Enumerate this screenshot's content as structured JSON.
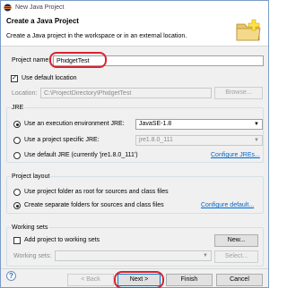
{
  "window": {
    "title": "New Java Project"
  },
  "banner": {
    "heading": "Create a Java Project",
    "description": "Create a Java project in the workspace or in an external location."
  },
  "project_name": {
    "label": "Project name:",
    "value": "PhidgetTest"
  },
  "location": {
    "use_default_label": "Use default location",
    "use_default_checked": true,
    "label": "Location:",
    "value": "C:\\ProjectDirectory\\PhidgetTest",
    "browse_label": "Browse..."
  },
  "jre": {
    "group_label": "JRE",
    "options": [
      {
        "label": "Use an execution environment JRE:",
        "selected": true,
        "value": "JavaSE-1.8"
      },
      {
        "label": "Use a project specific JRE:",
        "selected": false,
        "value": "jre1.8.0_111"
      },
      {
        "label": "Use default JRE (currently 'jre1.8.0_111')",
        "selected": false,
        "link": "Configure JREs..."
      }
    ]
  },
  "project_layout": {
    "group_label": "Project layout",
    "options": [
      {
        "label": "Use project folder as root for sources and class files",
        "selected": false
      },
      {
        "label": "Create separate folders for sources and class files",
        "selected": true,
        "link": "Configure default..."
      }
    ]
  },
  "working_sets": {
    "group_label": "Working sets",
    "add_label": "Add project to working sets",
    "add_checked": false,
    "new_label": "New...",
    "sets_label": "Working sets:",
    "select_label": "Select..."
  },
  "footer": {
    "help_glyph": "?",
    "back_label": "< Back",
    "next_label": "Next >",
    "finish_label": "Finish",
    "cancel_label": "Cancel"
  },
  "colors": {
    "highlight": "#d9232e",
    "link": "#0066cc",
    "accent": "#0078d7"
  }
}
